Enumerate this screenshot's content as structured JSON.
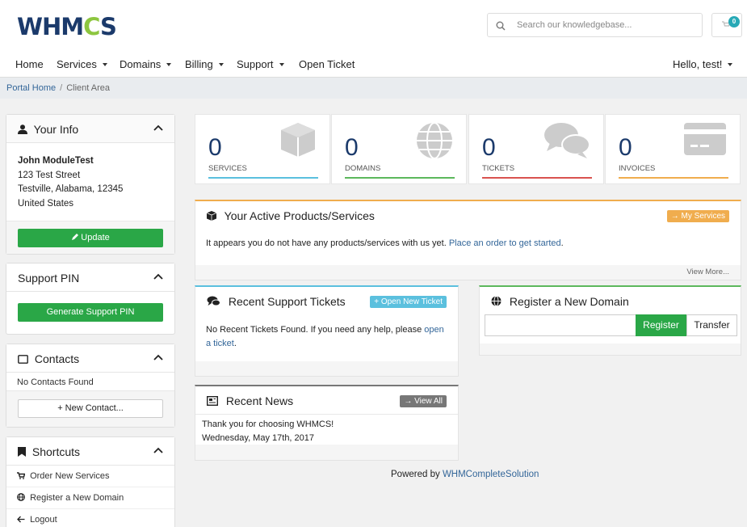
{
  "brand": {
    "logo_text_pre": "WHM",
    "logo_text_gear": "C",
    "logo_text_post": "S"
  },
  "header": {
    "search_placeholder": "Search our knowledgebase...",
    "cart_count": "0"
  },
  "nav": {
    "home": "Home",
    "services": "Services",
    "domains": "Domains",
    "billing": "Billing",
    "support": "Support",
    "open_ticket": "Open Ticket",
    "user": "Hello, test!"
  },
  "breadcrumb": {
    "home": "Portal Home",
    "sep": "/",
    "current": "Client Area"
  },
  "your_info": {
    "title": "Your Info",
    "name": "John ModuleTest",
    "street": "123 Test Street",
    "city": "Testville, Alabama, 12345",
    "country": "United States",
    "update_label": "Update"
  },
  "support_pin": {
    "title": "Support PIN",
    "button": "Generate Support PIN"
  },
  "contacts": {
    "title": "Contacts",
    "empty": "No Contacts Found",
    "button": "+ New Contact..."
  },
  "shortcuts": {
    "title": "Shortcuts",
    "items": [
      "Order New Services",
      "Register a New Domain",
      "Logout"
    ]
  },
  "stats": [
    {
      "value": "0",
      "label": "SERVICES",
      "color": "#5bc0de"
    },
    {
      "value": "0",
      "label": "DOMAINS",
      "color": "#5cb85c"
    },
    {
      "value": "0",
      "label": "TICKETS",
      "color": "#d9534f"
    },
    {
      "value": "0",
      "label": "INVOICES",
      "color": "#f0ad4e"
    }
  ],
  "products": {
    "title": "Your Active Products/Services",
    "button": "My Services",
    "text": "It appears you do not have any products/services with us yet.",
    "link": "Place an order to get started",
    "link_end": ".",
    "view_more": "View More..."
  },
  "tickets": {
    "title": "Recent Support Tickets",
    "button": "Open New Ticket",
    "text": "No Recent Tickets Found. If you need any help, please",
    "link": "open a ticket",
    "link_end": "."
  },
  "register_domain": {
    "title": "Register a New Domain",
    "register": "Register",
    "transfer": "Transfer"
  },
  "news": {
    "title": "Recent News",
    "button": "View All",
    "headline": "Thank you for choosing WHMCS!",
    "date": "Wednesday, May 17th, 2017"
  },
  "footer": {
    "powered": "Powered by",
    "link": "WHMCompleteSolution"
  },
  "colors": {
    "green": "#2aa747",
    "navy": "#1b3a6b",
    "orange": "#f0ad4e",
    "teal": "#5bc0de",
    "gray": "#777777"
  }
}
